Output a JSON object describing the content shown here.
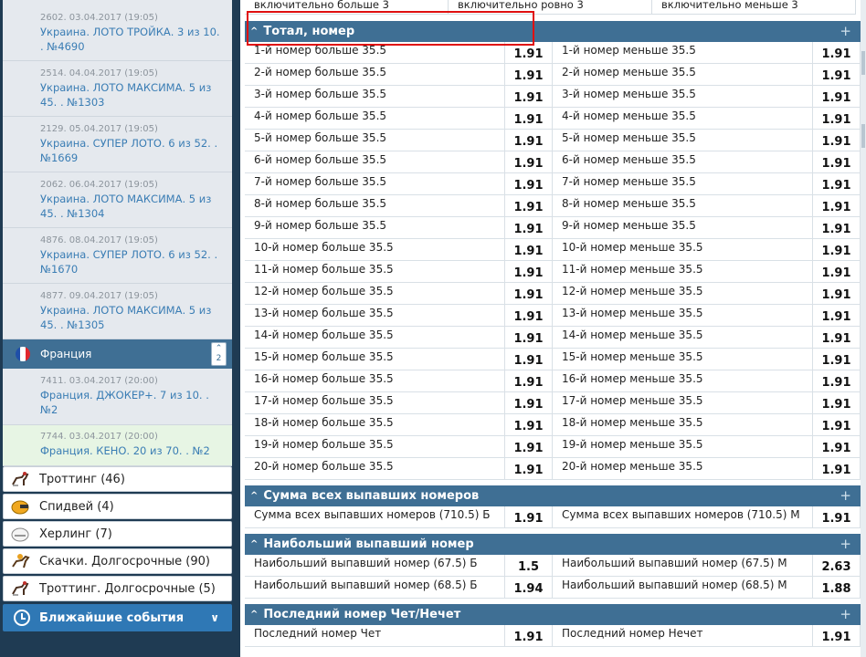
{
  "sidebar": {
    "events_top": [
      {
        "date": "2602. 03.04.2017 (19:05)",
        "title": "Украина. ЛОТО ТРОЙКА. 3 из 10. . №4690"
      },
      {
        "date": "2514. 04.04.2017 (19:05)",
        "title": "Украина. ЛОТО МАКСИМА. 5 из 45. . №1303"
      },
      {
        "date": "2129. 05.04.2017 (19:05)",
        "title": "Украина. СУПЕР ЛОТО. 6 из 52. . №1669"
      },
      {
        "date": "2062. 06.04.2017 (19:05)",
        "title": "Украина. ЛОТО МАКСИМА. 5 из 45. . №1304"
      },
      {
        "date": "4876. 08.04.2017 (19:05)",
        "title": "Украина. СУПЕР ЛОТО. 6 из 52. . №1670"
      },
      {
        "date": "4877. 09.04.2017 (19:05)",
        "title": "Украина. ЛОТО МАКСИМА. 5 из 45. . №1305"
      }
    ],
    "country": {
      "label": "Франция",
      "count": "2",
      "flag_colors": [
        "#1f4fa8",
        "#ffffff",
        "#e0262d"
      ]
    },
    "events_france": [
      {
        "date": "7411. 03.04.2017 (20:00)",
        "title": "Франция. ДЖОКЕР+. 7 из 10. . №2"
      },
      {
        "date": "7744. 03.04.2017 (20:00)",
        "title": "Франция. КЕНО. 20 из 70. . №2"
      }
    ],
    "sports": [
      {
        "label": "Троттинг (46)",
        "icon": "trotting-horse-icon"
      },
      {
        "label": "Спидвей (4)",
        "icon": "speedway-helmet-icon"
      },
      {
        "label": "Херлинг (7)",
        "icon": "hurling-helmet-icon"
      },
      {
        "label": "Скачки. Долгосрочные (90)",
        "icon": "horse-racing-icon"
      },
      {
        "label": "Троттинг. Долгосрочные (5)",
        "icon": "trotting-horse-icon"
      }
    ],
    "nearest": {
      "label": "Ближайшие события",
      "icon": "clock-icon"
    }
  },
  "main": {
    "top_row": [
      "включительно больше 3",
      "включительно ровно 3",
      "включительно меньше 3"
    ],
    "markets": [
      {
        "title": "Тотал, номер",
        "rows": [
          [
            {
              "name": "1-й номер больше 35.5",
              "odd": "1.91"
            },
            {
              "name": "1-й номер меньше 35.5",
              "odd": "1.91"
            }
          ],
          [
            {
              "name": "2-й номер больше 35.5",
              "odd": "1.91"
            },
            {
              "name": "2-й номер меньше 35.5",
              "odd": "1.91"
            }
          ],
          [
            {
              "name": "3-й номер больше 35.5",
              "odd": "1.91"
            },
            {
              "name": "3-й номер меньше 35.5",
              "odd": "1.91"
            }
          ],
          [
            {
              "name": "4-й номер больше 35.5",
              "odd": "1.91"
            },
            {
              "name": "4-й номер меньше 35.5",
              "odd": "1.91"
            }
          ],
          [
            {
              "name": "5-й номер больше 35.5",
              "odd": "1.91"
            },
            {
              "name": "5-й номер меньше 35.5",
              "odd": "1.91"
            }
          ],
          [
            {
              "name": "6-й номер больше 35.5",
              "odd": "1.91"
            },
            {
              "name": "6-й номер меньше 35.5",
              "odd": "1.91"
            }
          ],
          [
            {
              "name": "7-й номер больше 35.5",
              "odd": "1.91"
            },
            {
              "name": "7-й номер меньше 35.5",
              "odd": "1.91"
            }
          ],
          [
            {
              "name": "8-й номер больше 35.5",
              "odd": "1.91"
            },
            {
              "name": "8-й номер меньше 35.5",
              "odd": "1.91"
            }
          ],
          [
            {
              "name": "9-й номер больше 35.5",
              "odd": "1.91"
            },
            {
              "name": "9-й номер меньше 35.5",
              "odd": "1.91"
            }
          ],
          [
            {
              "name": "10-й номер больше 35.5",
              "odd": "1.91"
            },
            {
              "name": "10-й номер меньше 35.5",
              "odd": "1.91"
            }
          ],
          [
            {
              "name": "11-й номер больше 35.5",
              "odd": "1.91"
            },
            {
              "name": "11-й номер меньше 35.5",
              "odd": "1.91"
            }
          ],
          [
            {
              "name": "12-й номер больше 35.5",
              "odd": "1.91"
            },
            {
              "name": "12-й номер меньше 35.5",
              "odd": "1.91"
            }
          ],
          [
            {
              "name": "13-й номер больше 35.5",
              "odd": "1.91"
            },
            {
              "name": "13-й номер меньше 35.5",
              "odd": "1.91"
            }
          ],
          [
            {
              "name": "14-й номер больше 35.5",
              "odd": "1.91"
            },
            {
              "name": "14-й номер меньше 35.5",
              "odd": "1.91"
            }
          ],
          [
            {
              "name": "15-й номер больше 35.5",
              "odd": "1.91"
            },
            {
              "name": "15-й номер меньше 35.5",
              "odd": "1.91"
            }
          ],
          [
            {
              "name": "16-й номер больше 35.5",
              "odd": "1.91"
            },
            {
              "name": "16-й номер меньше 35.5",
              "odd": "1.91"
            }
          ],
          [
            {
              "name": "17-й номер больше 35.5",
              "odd": "1.91"
            },
            {
              "name": "17-й номер меньше 35.5",
              "odd": "1.91"
            }
          ],
          [
            {
              "name": "18-й номер больше 35.5",
              "odd": "1.91"
            },
            {
              "name": "18-й номер меньше 35.5",
              "odd": "1.91"
            }
          ],
          [
            {
              "name": "19-й номер больше 35.5",
              "odd": "1.91"
            },
            {
              "name": "19-й номер меньше 35.5",
              "odd": "1.91"
            }
          ],
          [
            {
              "name": "20-й номер больше 35.5",
              "odd": "1.91"
            },
            {
              "name": "20-й номер меньше 35.5",
              "odd": "1.91"
            }
          ]
        ]
      },
      {
        "title": "Сумма всех выпавших номеров",
        "rows": [
          [
            {
              "name": "Сумма всех выпавших номеров (710.5) Б",
              "odd": "1.91"
            },
            {
              "name": "Сумма всех выпавших номеров (710.5) М",
              "odd": "1.91"
            }
          ]
        ]
      },
      {
        "title": "Наибольший выпавший номер",
        "rows": [
          [
            {
              "name": "Наибольший выпавший номер (67.5) Б",
              "odd": "1.5"
            },
            {
              "name": "Наибольший выпавший номер (67.5) М",
              "odd": "2.63"
            }
          ],
          [
            {
              "name": "Наибольший выпавший номер (68.5) Б",
              "odd": "1.94"
            },
            {
              "name": "Наибольший выпавший номер (68.5) М",
              "odd": "1.88"
            }
          ]
        ]
      },
      {
        "title": "Последний номер Чет/Нечет",
        "rows": [
          [
            {
              "name": "Последний номер Чет",
              "odd": "1.91"
            },
            {
              "name": "Последний номер Нечет",
              "odd": "1.91"
            }
          ]
        ]
      }
    ]
  },
  "colors": {
    "header_blue": "#3f6f94",
    "link_blue": "#3a7db4",
    "highlight": "#e01010",
    "sidebar_bg": "#1f3b53"
  }
}
